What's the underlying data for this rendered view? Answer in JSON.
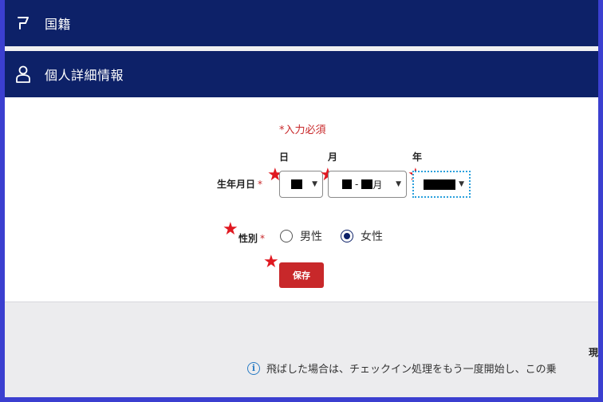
{
  "sections": {
    "nationality": {
      "title": "国籍",
      "icon": "flag-icon"
    },
    "personal": {
      "title": "個人詳細情報",
      "icon": "person-icon"
    }
  },
  "form": {
    "required_note": "*入力必須",
    "columns": {
      "day": "日",
      "month": "月",
      "year": "年"
    },
    "dob_label": "生年月日",
    "gender_label": "性別",
    "asterisk": "*",
    "month_suffix": "月",
    "month_separator": "-",
    "gender_options": [
      {
        "label": "男性",
        "selected": false
      },
      {
        "label": "女性",
        "selected": true
      }
    ],
    "save_label": "保存"
  },
  "footer": {
    "truncated_text": "現",
    "info_text": "飛ばした場合は、チェックイン処理をもう一度開始し、この乗"
  },
  "colors": {
    "header": "#0d2168",
    "accent": "#c8282a",
    "annotation_star": "#e01820"
  }
}
